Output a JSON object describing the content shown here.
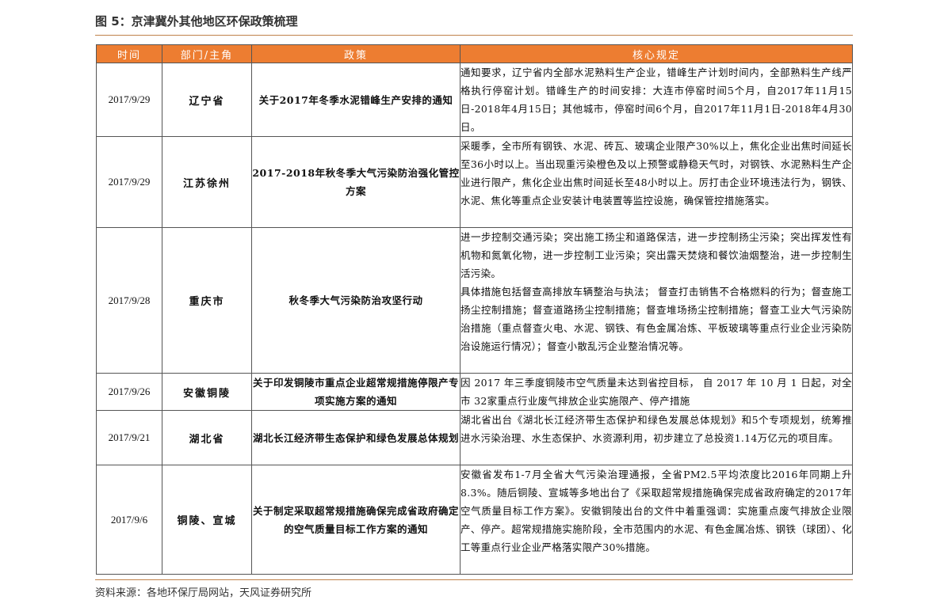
{
  "title": "图 5：京津冀外其他地区环保政策梳理",
  "headers": {
    "time": "时间",
    "dept": "部门/主角",
    "policy": "政策",
    "rules": "核心规定"
  },
  "rows": [
    {
      "time": "2017/9/29",
      "dept": "辽宁省",
      "policy": "关于2017年冬季水泥错峰生产安排的通知",
      "rules": [
        "通知要求，辽宁省内全部水泥熟料生产企业，错峰生产计划时间内，全部熟料生产线严格执行停窑计划。错峰生产的时间安排：大连市停窑时间5个月，自2017年11月15日-2018年4月15日；其他城市，停窑时间6个月，自2017年11月1日-2018年4月30日。"
      ]
    },
    {
      "time": "2017/9/29",
      "dept": "江苏徐州",
      "policy": "2017-2018年秋冬季大气污染防治强化管控方案",
      "rules": [
        "采暖季，全市所有钢铁、水泥、砖瓦、玻璃企业限产30%以上，焦化企业出焦时间延长至36小时以上。当出现重污染橙色及以上预警或静稳天气时，对钢铁、水泥熟料生产企业进行限产，焦化企业出焦时间延长至48小时以上。厉打击企业环境违法行为，钢铁、水泥、焦化等重点企业安装计电装置等监控设施，确保管控措施落实。"
      ]
    },
    {
      "time": "2017/9/28",
      "dept": "重庆市",
      "policy": "秋冬季大气污染防治攻坚行动",
      "rules": [
        "进一步控制交通污染；突出施工扬尘和道路保洁，进一步控制扬尘污染；突出挥发性有机物和氮氧化物，进一步控制工业污染；突出露天焚烧和餐饮油烟整治，进一步控制生活污染。",
        "具体措施包括督查高排放车辆整治与执法； 督查打击销售不合格燃料的行为；督查施工扬尘控制措施；督查道路扬尘控制措施；督查堆场扬尘控制措施；督查工业大气污染防治措施（重点督查火电、水泥、钢铁、有色金属冶炼、平板玻璃等重点行业企业污染防治设施运行情况）；督查小散乱污企业整治情况等。"
      ]
    },
    {
      "time": "2017/9/26",
      "dept": "安徽铜陵",
      "policy": "关于印发铜陵市重点企业超常规措施停限产专项实施方案的通知",
      "rules": [
        "因 2017 年三季度铜陵市空气质量未达到省控目标， 自 2017 年 10 月 1 日起，对全市 32家重点行业废气排放企业实施限产、停产措施"
      ]
    },
    {
      "time": "2017/9/21",
      "dept": "湖北省",
      "policy": "湖北长江经济带生态保护和绿色发展总体规划",
      "rules": [
        "湖北省出台《湖北长江经济带生态保护和绿色发展总体规划》和5个专项规划，统筹推进水污染治理、水生态保护、水资源利用，初步建立了总投资1.14万亿元的项目库。"
      ]
    },
    {
      "time": "2017/9/6",
      "dept": "铜陵、宣城",
      "policy": "关于制定采取超常规措施确保完成省政府确定的空气质量目标工作方案的通知",
      "rules": [
        "安徽省发布1-7月全省大气污染治理通报，全省PM2.5平均浓度比2016年同期上升8.3%。随后铜陵、宣城等多地出台了《采取超常规措施确保完成省政府确定的2017年空气质量目标工作方案》。安徽铜陵出台的文件中着重强调：实施重点废气排放企业限产、停产。超常规措施实施阶段，全市范围内的水泥、有色金属冶炼、钢铁（球团）、化工等重点行业企业严格落实限产30%措施。"
      ]
    }
  ],
  "source": "资料来源：各地环保厅局网站，天风证券研究所",
  "colors": {
    "header_bg": "#ed7d31",
    "header_text": "#ffffff",
    "rule_line": "#c0824a"
  }
}
